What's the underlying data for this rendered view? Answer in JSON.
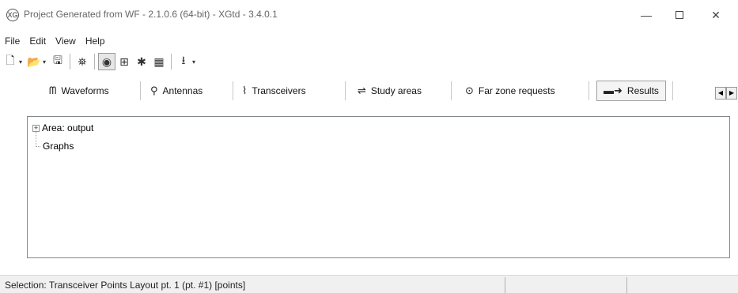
{
  "window": {
    "title": "Project Generated from WF - 2.1.0.6 (64-bit) - XGtd  - 3.4.0.1",
    "app_icon_glyph": "XG",
    "minimize_glyph": "—",
    "close_glyph": "✕"
  },
  "menu": {
    "items": [
      "File",
      "Edit",
      "View",
      "Help"
    ]
  },
  "toolbar": {
    "buttons": [
      {
        "icon": "new-document-icon",
        "glyph": "🗋"
      },
      {
        "icon": "open-folder-icon",
        "glyph": "📂"
      },
      {
        "icon": "save-icon",
        "glyph": "🖫"
      },
      {
        "icon": "project-view-icon",
        "glyph": "⛯"
      },
      {
        "icon": "globe-icon",
        "glyph": "◉"
      },
      {
        "icon": "tree-view-icon",
        "glyph": "⊞"
      },
      {
        "icon": "run-icon",
        "glyph": "✱"
      },
      {
        "icon": "render-icon",
        "glyph": "▦"
      },
      {
        "icon": "download-icon",
        "glyph": "⭳"
      }
    ],
    "dropdown_glyph": "▾"
  },
  "tabs": [
    {
      "label": "Waveforms",
      "glyph": "ᗰ",
      "icon": "waveform-icon"
    },
    {
      "label": "Antennas",
      "glyph": "⚲",
      "icon": "antenna-icon"
    },
    {
      "label": "Transceivers",
      "glyph": "⌇",
      "icon": "transceiver-icon"
    },
    {
      "label": "Study areas",
      "glyph": "⇌",
      "icon": "study-area-icon"
    },
    {
      "label": "Far zone requests",
      "glyph": "⊙",
      "icon": "far-zone-icon"
    },
    {
      "label": "Results",
      "glyph": "▬➜",
      "icon": "results-icon"
    }
  ],
  "tab_scroll": {
    "left": "◀",
    "right": "▶"
  },
  "tree": {
    "items": [
      {
        "label": "Area: output",
        "expander": "+"
      },
      {
        "label": "Graphs"
      }
    ]
  },
  "status": {
    "text": "Selection: Transceiver Points Layout pt. 1 (pt. #1) [points]"
  }
}
